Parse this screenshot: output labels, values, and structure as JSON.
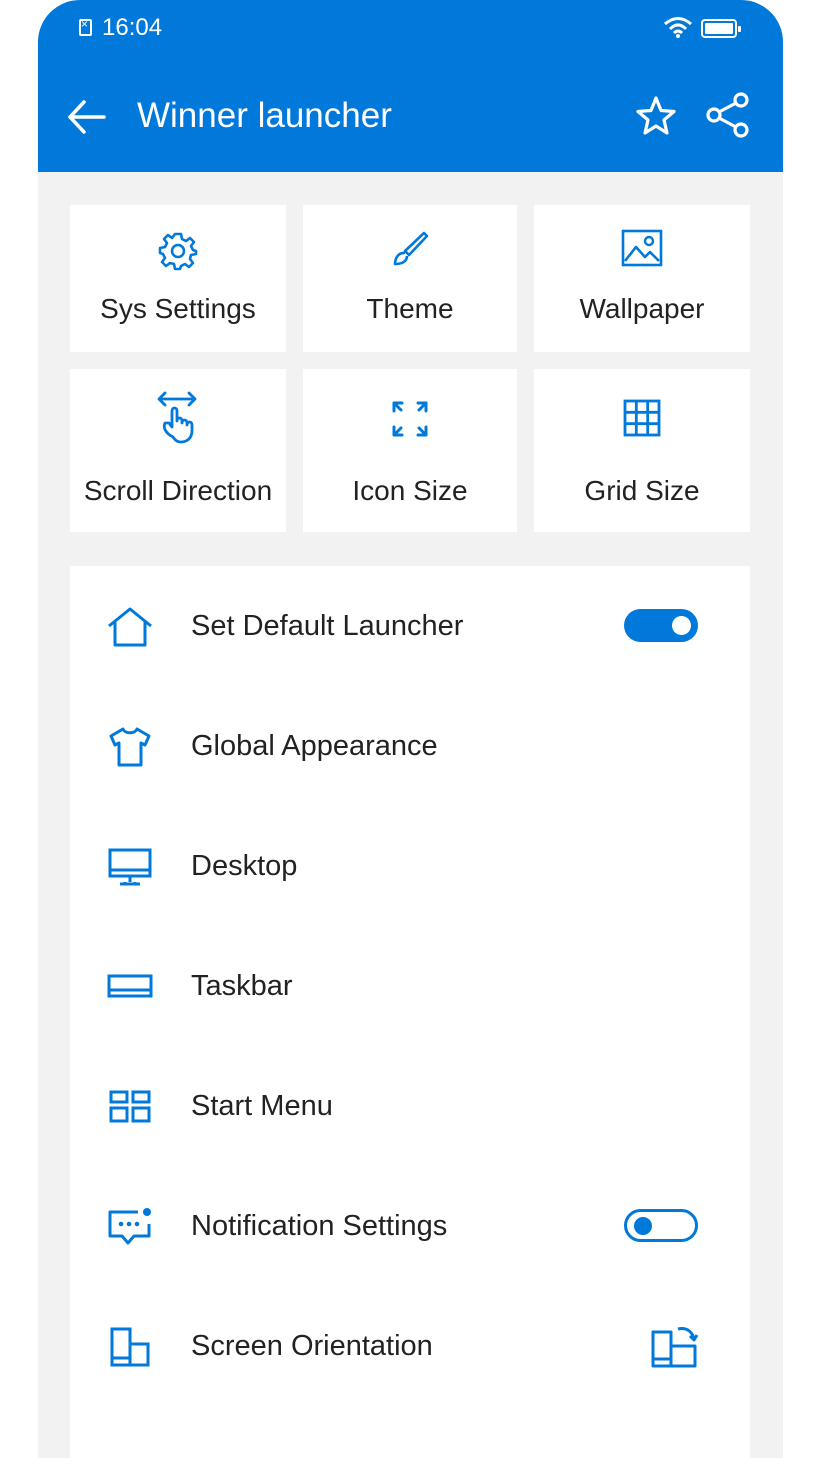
{
  "status_bar": {
    "time": "16:04"
  },
  "header": {
    "title": "Winner launcher"
  },
  "tiles": [
    {
      "label": "Sys Settings",
      "icon": "gear-icon"
    },
    {
      "label": "Theme",
      "icon": "brush-icon"
    },
    {
      "label": "Wallpaper",
      "icon": "image-icon"
    },
    {
      "label": "Scroll Direction",
      "icon": "swipe-hand-icon"
    },
    {
      "label": "Icon Size",
      "icon": "expand-arrows-icon"
    },
    {
      "label": "Grid Size",
      "icon": "grid-icon"
    }
  ],
  "settings": [
    {
      "label": "Set Default Launcher",
      "icon": "home-icon",
      "toggle": true
    },
    {
      "label": "Global Appearance",
      "icon": "shirt-icon"
    },
    {
      "label": "Desktop",
      "icon": "monitor-icon"
    },
    {
      "label": "Taskbar",
      "icon": "taskbar-icon"
    },
    {
      "label": "Start Menu",
      "icon": "start-menu-icon"
    },
    {
      "label": "Notification Settings",
      "icon": "notification-icon",
      "toggle": false
    },
    {
      "label": "Screen Orientation",
      "icon": "device-icon",
      "trailing_icon": "rotate-screen-icon"
    }
  ],
  "colors": {
    "accent": "#0179db",
    "background": "#f2f2f2"
  }
}
